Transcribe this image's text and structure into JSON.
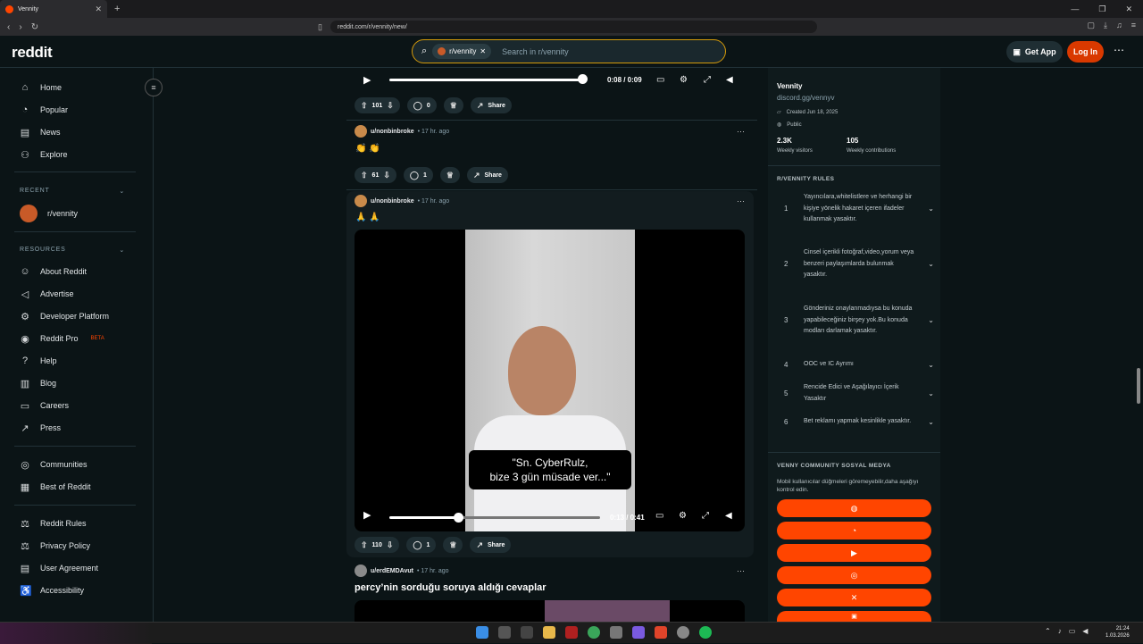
{
  "browser": {
    "tab_title": "Vennity",
    "url": "reddit.com/r/vennity/new/"
  },
  "header": {
    "logo": "reddit",
    "search_chip": "r/vennity",
    "search_placeholder": "Search in r/vennity",
    "get_app": "Get App",
    "login": "Log In"
  },
  "nav": {
    "items": [
      "Home",
      "Popular",
      "News",
      "Explore"
    ],
    "recent_label": "RECENT",
    "recent_item": "r/vennity",
    "resources_label": "RESOURCES",
    "resources": [
      "About Reddit",
      "Advertise",
      "Developer Platform",
      "Reddit Pro",
      "Help",
      "Blog",
      "Careers",
      "Press"
    ],
    "beta": "BETA",
    "more": [
      "Communities",
      "Best of Reddit"
    ],
    "policies": [
      "Reddit Rules",
      "Privacy Policy",
      "User Agreement",
      "Accessibility"
    ]
  },
  "posts": [
    {
      "video_time": "0:08 / 0:09",
      "votes": "101",
      "comments": "0",
      "share": "Share"
    },
    {
      "user": "u/nonbinbroke",
      "time": "17 hr. ago",
      "emoji": "👏 👏",
      "votes": "61",
      "comments": "1",
      "share": "Share"
    },
    {
      "user": "u/nonbinbroke",
      "time": "17 hr. ago",
      "emoji": "🙏 🙏",
      "caption_line1": "\"Sn. CyberRulz,",
      "caption_line2": "bize 3 gün müsade ver...\"",
      "video_time": "0:13 / 0:41",
      "votes": "110",
      "comments": "1",
      "share": "Share"
    },
    {
      "user": "u/erdEMDAvut",
      "time": "17 hr. ago",
      "title": "percy’nin sorduğu soruya aldığı cevaplar"
    }
  ],
  "sidebar": {
    "name": "Vennity",
    "link": "discord.gg/vennyv",
    "created": "Created Jun 18, 2025",
    "visibility": "Public",
    "visitors": "2.3K",
    "visitors_label": "Weekly visitors",
    "contributions": "105",
    "contributions_label": "Weekly contributions",
    "rules_title": "R/VENNITY RULES",
    "rules": [
      {
        "num": "1",
        "text": "Yayıncılara,whitelistlere ve herhangi bir kişiye yönelik hakaret içeren ifadeler kullanmak yasaktır."
      },
      {
        "num": "2",
        "text": "Cinsel içerikli fotoğraf,video,yorum veya benzeri paylaşımlarda bulunmak yasaktır."
      },
      {
        "num": "3",
        "text": "Gönderiniz onaylanmadıysa bu konuda yapabileceğiniz birşey yok.Bu konuda modları darlamak yasaktır."
      },
      {
        "num": "4",
        "text": "OOC ve IC Ayrımı"
      },
      {
        "num": "5",
        "text": "Rencide Edici ve Aşağılayıcı İçerik Yasaktır"
      },
      {
        "num": "6",
        "text": "Bet reklamı yapmak kesinlikle yasaktır."
      }
    ],
    "social_title": "VENNY COMMUNITY SOSYAL MEDYA",
    "social_note": "Mobil kullanıcılar düğmeleri göremeyebilir,daha aşağıyı kontrol edin."
  },
  "taskbar": {
    "time": "21:24",
    "date": "1.03.2026"
  },
  "colors": {
    "accent": "#ff4500",
    "bg": "#0b1416"
  }
}
